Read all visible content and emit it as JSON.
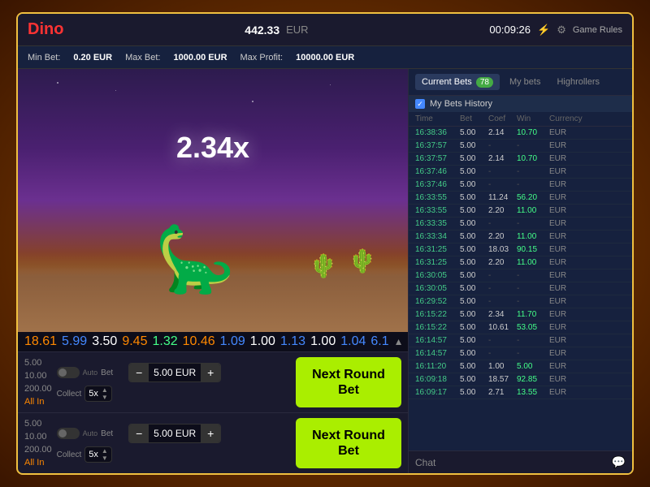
{
  "header": {
    "logo": "Dino",
    "balance": "442.33",
    "currency": "EUR",
    "timer": "00:09:26",
    "game_rules": "Game Rules"
  },
  "sub_header": {
    "min_bet_label": "Min Bet:",
    "min_bet_value": "0.20 EUR",
    "max_bet_label": "Max Bet:",
    "max_bet_value": "1000.00 EUR",
    "max_profit_label": "Max Profit:",
    "max_profit_value": "10000.00 EUR"
  },
  "game": {
    "multiplier": "2.34x"
  },
  "multiplier_bar": [
    {
      "value": "18.61",
      "class": "mult-orange"
    },
    {
      "value": "5.99",
      "class": "mult-blue"
    },
    {
      "value": "3.50",
      "class": "mult-white"
    },
    {
      "value": "9.45",
      "class": "mult-orange"
    },
    {
      "value": "1.32",
      "class": "mult-green"
    },
    {
      "value": "10.46",
      "class": "mult-orange"
    },
    {
      "value": "1.09",
      "class": "mult-blue"
    },
    {
      "value": "1.00",
      "class": "mult-white"
    },
    {
      "value": "1.13",
      "class": "mult-blue"
    },
    {
      "value": "1.00",
      "class": "mult-white"
    },
    {
      "value": "1.04",
      "class": "mult-blue"
    },
    {
      "value": "6.1",
      "class": "mult-blue"
    }
  ],
  "bet_panel_1": {
    "value_top": "5.00",
    "value_bottom": "10.00",
    "bet_label": "Bet",
    "bet_amount": "5.00",
    "bet_currency": "EUR",
    "collect_label": "Collect",
    "collect_value": "5x",
    "next_round": "Next Round Bet",
    "auto_label": "Auto"
  },
  "bet_panel_2": {
    "value_top": "5.00",
    "value_bottom": "10.00",
    "bet_label": "Bet",
    "bet_amount": "5.00",
    "bet_currency": "EUR",
    "collect_label": "Collect",
    "collect_value": "5x",
    "next_round": "Next Round Bet",
    "auto_label": "Auto"
  },
  "side_vals_1": {
    "val1": "5.00",
    "val2": "10.00",
    "val3": "200.00",
    "val4": "All In"
  },
  "side_vals_2": {
    "val1": "5.00",
    "val2": "10.00",
    "val3": "200.00",
    "val4": "All In"
  },
  "right_panel": {
    "tabs": [
      {
        "label": "Current Bets",
        "active": true
      },
      {
        "label": "My bets",
        "active": false
      },
      {
        "label": "Highrollers",
        "active": false
      }
    ],
    "badge": "78",
    "history_label": "My Bets History",
    "columns": [
      "Time",
      "Bet",
      "Coef",
      "Win",
      "Currency"
    ],
    "rows": [
      {
        "time": "16:38:36",
        "bet": "5.00",
        "coef": "2.14",
        "win": "10.70",
        "cur": "EUR",
        "win_color": true
      },
      {
        "time": "16:37:57",
        "bet": "5.00",
        "coef": "-",
        "win": "-",
        "cur": "EUR",
        "win_color": false
      },
      {
        "time": "16:37:57",
        "bet": "5.00",
        "coef": "2.14",
        "win": "10.70",
        "cur": "EUR",
        "win_color": true
      },
      {
        "time": "16:37:46",
        "bet": "5.00",
        "coef": "-",
        "win": "-",
        "cur": "EUR",
        "win_color": false
      },
      {
        "time": "16:37:46",
        "bet": "5.00",
        "coef": "-",
        "win": "-",
        "cur": "EUR",
        "win_color": false
      },
      {
        "time": "16:33:55",
        "bet": "5.00",
        "coef": "11.24",
        "win": "56.20",
        "cur": "EUR",
        "win_color": true
      },
      {
        "time": "16:33:55",
        "bet": "5.00",
        "coef": "2.20",
        "win": "11.00",
        "cur": "EUR",
        "win_color": true
      },
      {
        "time": "16:33:35",
        "bet": "5.00",
        "coef": "-",
        "win": "-",
        "cur": "EUR",
        "win_color": false
      },
      {
        "time": "16:33:34",
        "bet": "5.00",
        "coef": "2.20",
        "win": "11.00",
        "cur": "EUR",
        "win_color": true
      },
      {
        "time": "16:31:25",
        "bet": "5.00",
        "coef": "18.03",
        "win": "90.15",
        "cur": "EUR",
        "win_color": true
      },
      {
        "time": "16:31:25",
        "bet": "5.00",
        "coef": "2.20",
        "win": "11.00",
        "cur": "EUR",
        "win_color": true
      },
      {
        "time": "16:30:05",
        "bet": "5.00",
        "coef": "-",
        "win": "-",
        "cur": "EUR",
        "win_color": false
      },
      {
        "time": "16:30:05",
        "bet": "5.00",
        "coef": "-",
        "win": "-",
        "cur": "EUR",
        "win_color": false
      },
      {
        "time": "16:29:52",
        "bet": "5.00",
        "coef": "-",
        "win": "-",
        "cur": "EUR",
        "win_color": false
      },
      {
        "time": "16:15:22",
        "bet": "5.00",
        "coef": "2.34",
        "win": "11.70",
        "cur": "EUR",
        "win_color": true
      },
      {
        "time": "16:15:22",
        "bet": "5.00",
        "coef": "10.61",
        "win": "53.05",
        "cur": "EUR",
        "win_color": true
      },
      {
        "time": "16:14:57",
        "bet": "5.00",
        "coef": "-",
        "win": "-",
        "cur": "EUR",
        "win_color": false
      },
      {
        "time": "16:14:57",
        "bet": "5.00",
        "coef": "-",
        "win": "-",
        "cur": "EUR",
        "win_color": false
      },
      {
        "time": "16:11:20",
        "bet": "5.00",
        "coef": "1.00",
        "win": "5.00",
        "cur": "EUR",
        "win_color": true
      },
      {
        "time": "16:09:18",
        "bet": "5.00",
        "coef": "18.57",
        "win": "92.85",
        "cur": "EUR",
        "win_color": true
      },
      {
        "time": "16:09:17",
        "bet": "5.00",
        "coef": "2.71",
        "win": "13.55",
        "cur": "EUR",
        "win_color": true
      }
    ],
    "chat_label": "Chat"
  }
}
